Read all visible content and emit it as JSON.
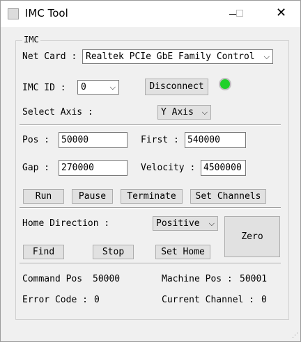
{
  "window": {
    "title": "IMC Tool",
    "close_glyph": "✕"
  },
  "group": {
    "title": "IMC"
  },
  "net_card": {
    "label": "Net Card :",
    "value": "Realtek PCIe GbE Family Control"
  },
  "imc_id": {
    "label": "IMC ID :",
    "value": "0"
  },
  "disconnect_label": "Disconnect",
  "status_led": {
    "color": "#1fd12a",
    "icon": "status-led-icon"
  },
  "axis": {
    "label": "Select Axis :",
    "value": "Y Axis"
  },
  "motion": {
    "pos_label": "Pos :",
    "pos_value": "50000",
    "first_label": "First :",
    "first_value": "540000",
    "gap_label": "Gap :",
    "gap_value": "270000",
    "velocity_label": "Velocity :",
    "velocity_value": "4500000"
  },
  "actions": {
    "run": "Run",
    "pause": "Pause",
    "terminate": "Terminate",
    "set_channels": "Set Channels"
  },
  "home": {
    "direction_label": "Home Direction :",
    "direction_value": "Positive",
    "find": "Find",
    "stop": "Stop",
    "set_home": "Set Home",
    "zero": "Zero"
  },
  "status": {
    "command_pos_label": "Command Pos",
    "command_pos_value": "50000",
    "machine_pos_label": "Machine Pos :",
    "machine_pos_value": "50001",
    "error_code_label": "Error Code :",
    "error_code_value": "0",
    "current_channel_label": "Current Channel :",
    "current_channel_value": "0"
  }
}
